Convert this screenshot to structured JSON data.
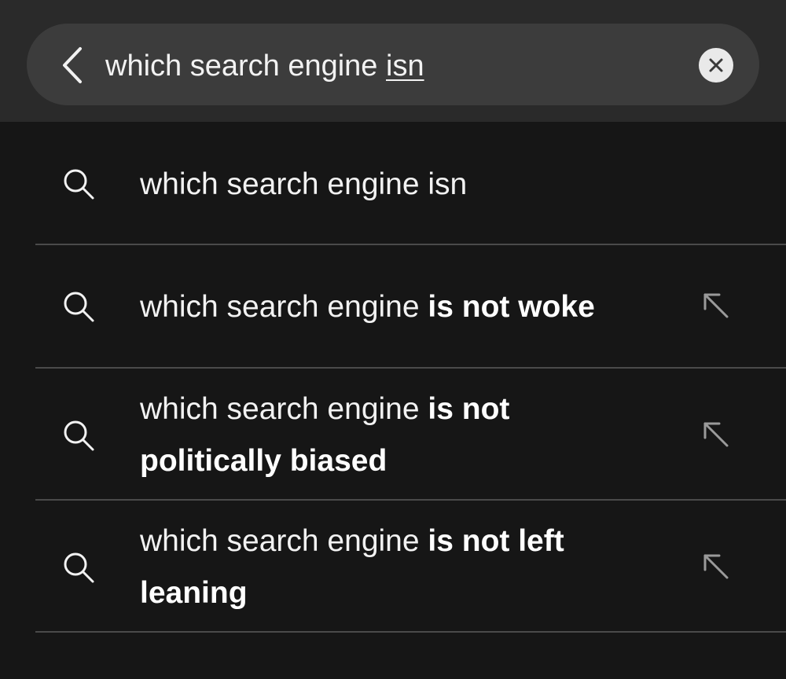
{
  "search_bar": {
    "query_prefix": "which search engine ",
    "query_underlined": "isn",
    "back_icon": "chevron-left-icon",
    "clear_icon": "close-icon"
  },
  "suggestions": [
    {
      "normal": "which search engine isn",
      "bold": "",
      "bold_line2": "",
      "has_arrow": false
    },
    {
      "normal": "which search engine ",
      "bold": "is not woke",
      "bold_line2": "",
      "has_arrow": true
    },
    {
      "normal": "which search engine ",
      "bold": "is not",
      "bold_line2": "politically biased",
      "has_arrow": true
    },
    {
      "normal": "which search engine ",
      "bold": "is not left",
      "bold_line2": "leaning",
      "has_arrow": true
    }
  ],
  "colors": {
    "header_bg": "#2a2a2a",
    "pill_bg": "#3c3c3c",
    "list_bg": "#161616",
    "divider": "#4a4a4a",
    "text": "#f2f2f2"
  }
}
